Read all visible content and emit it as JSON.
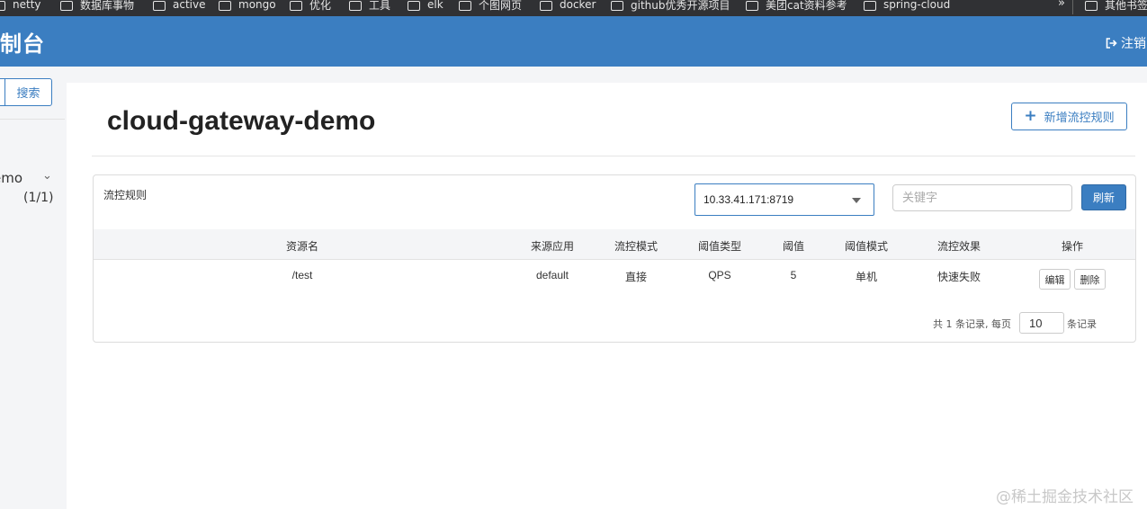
{
  "bookmarks": {
    "items": [
      {
        "label": "netty"
      },
      {
        "label": "数据库事物"
      },
      {
        "label": "active"
      },
      {
        "label": "mongo"
      },
      {
        "label": "优化"
      },
      {
        "label": "工具"
      },
      {
        "label": "elk"
      },
      {
        "label": "个图网页"
      },
      {
        "label": "docker"
      },
      {
        "label": "github优秀开源项目"
      },
      {
        "label": "美团cat资料参考"
      },
      {
        "label": "spring-cloud"
      }
    ],
    "overflow": "»",
    "other": "其他书签"
  },
  "header": {
    "title": "制台",
    "logout_label": "注销"
  },
  "sidebar": {
    "search_button": "搜索",
    "app_name": "emo",
    "app_count": "(1/1)"
  },
  "main": {
    "page_title": "cloud-gateway-demo",
    "add_rule_label": "新增流控规则"
  },
  "panel": {
    "title": "流控规则",
    "machine_select_value": "10.33.41.171:8719",
    "keyword_placeholder": "关键字",
    "refresh_label": "刷新"
  },
  "table": {
    "headers": {
      "resource": "资源名",
      "origin": "来源应用",
      "mode": "流控模式",
      "threshold_type": "阈值类型",
      "threshold": "阈值",
      "threshold_mode": "阈值模式",
      "effect": "流控效果",
      "actions": "操作"
    },
    "rows": [
      {
        "resource": "/test",
        "origin": "default",
        "mode": "直接",
        "threshold_type": "QPS",
        "threshold": "5",
        "threshold_mode": "单机",
        "effect": "快速失败",
        "edit_label": "编辑",
        "delete_label": "删除"
      }
    ]
  },
  "pagination": {
    "summary": "共 1 条记录, 每页",
    "page_size": "10",
    "suffix": "条记录"
  },
  "watermark": "@稀土掘金技术社区",
  "colors": {
    "header_blue": "#3b7ec1",
    "bookmarks_bg": "#303134"
  }
}
